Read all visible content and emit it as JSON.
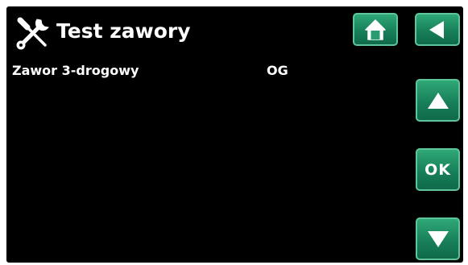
{
  "header": {
    "title": "Test zawory",
    "icon": "tools-icon"
  },
  "rows": [
    {
      "label": "Zawor 3-drogowy",
      "value": "OG"
    }
  ],
  "buttons": {
    "home": {
      "icon": "home-icon"
    },
    "back": {
      "icon": "back-arrow-icon"
    },
    "up": {
      "icon": "arrow-up-icon"
    },
    "ok": {
      "label": "OK"
    },
    "down": {
      "icon": "arrow-down-icon"
    }
  },
  "colors": {
    "background": "#000000",
    "button": "#18805a",
    "button_border": "#5fc69c",
    "text": "#ffffff"
  }
}
